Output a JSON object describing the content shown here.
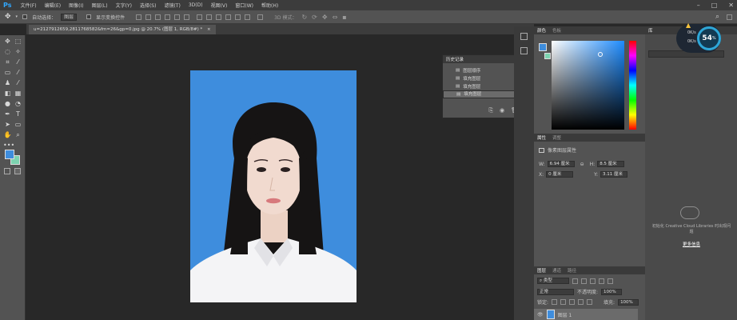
{
  "app": {
    "logo": "Ps"
  },
  "menu": [
    "文件(F)",
    "编辑(E)",
    "图像(I)",
    "图层(L)",
    "文字(Y)",
    "选择(S)",
    "滤镜(T)",
    "3D(D)",
    "视图(V)",
    "窗口(W)",
    "帮助(H)"
  ],
  "options": {
    "auto_select": "自动选择：",
    "layer_select": "图层",
    "show_transform": "显示变换控件",
    "mode_3d": "3D 模式："
  },
  "document": {
    "tab": "u=2127912659,2811768582&fm=26&gp=0.jpg @ 20.7% (图层 1, RGB/8#) *"
  },
  "history": {
    "title": "历史记录",
    "items": [
      "图层顺序",
      "填充图层",
      "填充图层",
      "填充图层"
    ]
  },
  "color_panel": {
    "tab_color": "颜色",
    "tab_swatches": "色板",
    "fg": "#3e8ddd",
    "bg": "#7dd3b0"
  },
  "properties": {
    "tab_props": "属性",
    "tab_adjust": "调整",
    "heading": "像素图层属性",
    "w_label": "W:",
    "w_value": "6.94 厘米",
    "h_label": "H:",
    "h_value": "8.5 厘米",
    "x_label": "X:",
    "x_value": "0 厘米",
    "y_label": "Y:",
    "y_value": "3.11 厘米"
  },
  "layers": {
    "tab_layers": "图层",
    "tab_channels": "通道",
    "tab_paths": "路径",
    "kind": "类型",
    "blend": "正常",
    "opacity_label": "不透明度:",
    "opacity": "100%",
    "lock_label": "锁定:",
    "fill_label": "填充:",
    "fill": "100%",
    "layer_name": "图层 1"
  },
  "library": {
    "tab": "库",
    "message": "初始化 Creative Cloud Libraries 时出现问题",
    "more": "更多信息"
  },
  "network": {
    "percent": "54",
    "unit": "%",
    "up": "0K/s",
    "down": "0K/s"
  }
}
